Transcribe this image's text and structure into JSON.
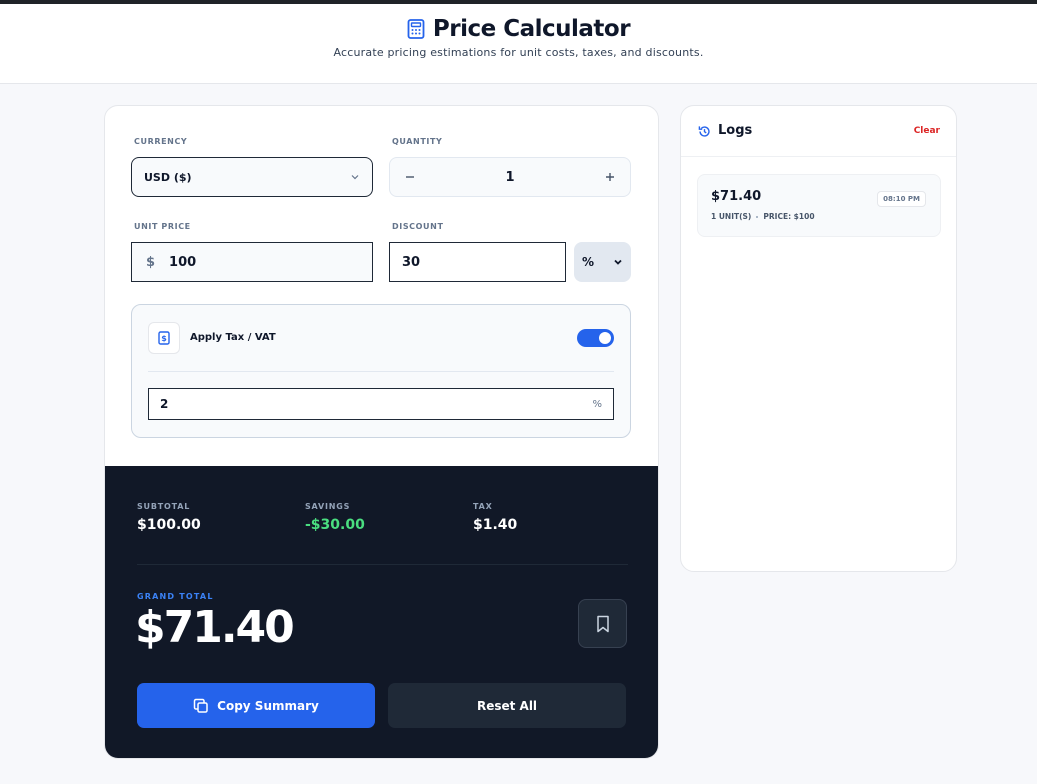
{
  "header": {
    "title": "Price Calculator",
    "subtitle": "Accurate pricing estimations for unit costs, taxes, and discounts."
  },
  "form": {
    "currency": {
      "label": "CURRENCY",
      "value": "USD ($)"
    },
    "quantity": {
      "label": "QUANTITY",
      "value": "1"
    },
    "unit_price": {
      "label": "UNIT PRICE",
      "symbol": "$",
      "value": "100"
    },
    "discount": {
      "label": "DISCOUNT",
      "value": "30",
      "type": "%"
    },
    "tax": {
      "label": "Apply Tax / VAT",
      "enabled": true,
      "value": "2",
      "unit": "%"
    }
  },
  "summary": {
    "subtotal_label": "SUBTOTAL",
    "subtotal": "$100.00",
    "savings_label": "SAVINGS",
    "savings": "-$30.00",
    "tax_label": "TAX",
    "tax": "$1.40",
    "grand_total_label": "GRAND TOTAL",
    "grand_total": "$71.40",
    "copy_label": "Copy Summary",
    "reset_label": "Reset All"
  },
  "logs": {
    "title": "Logs",
    "clear_label": "Clear",
    "items": [
      {
        "total": "$71.40",
        "time": "08:10 PM",
        "units": "1 UNIT(S)",
        "price": "PRICE: $100"
      }
    ]
  },
  "colors": {
    "accent": "#2563eb",
    "dark_panel": "#111827",
    "savings_green": "#4ade80",
    "clear_red": "#dc2626"
  },
  "icons": [
    "calculator-icon",
    "chevron-down-icon",
    "minus-icon",
    "plus-icon",
    "receipt-icon",
    "bookmark-icon",
    "copy-icon",
    "history-icon"
  ]
}
